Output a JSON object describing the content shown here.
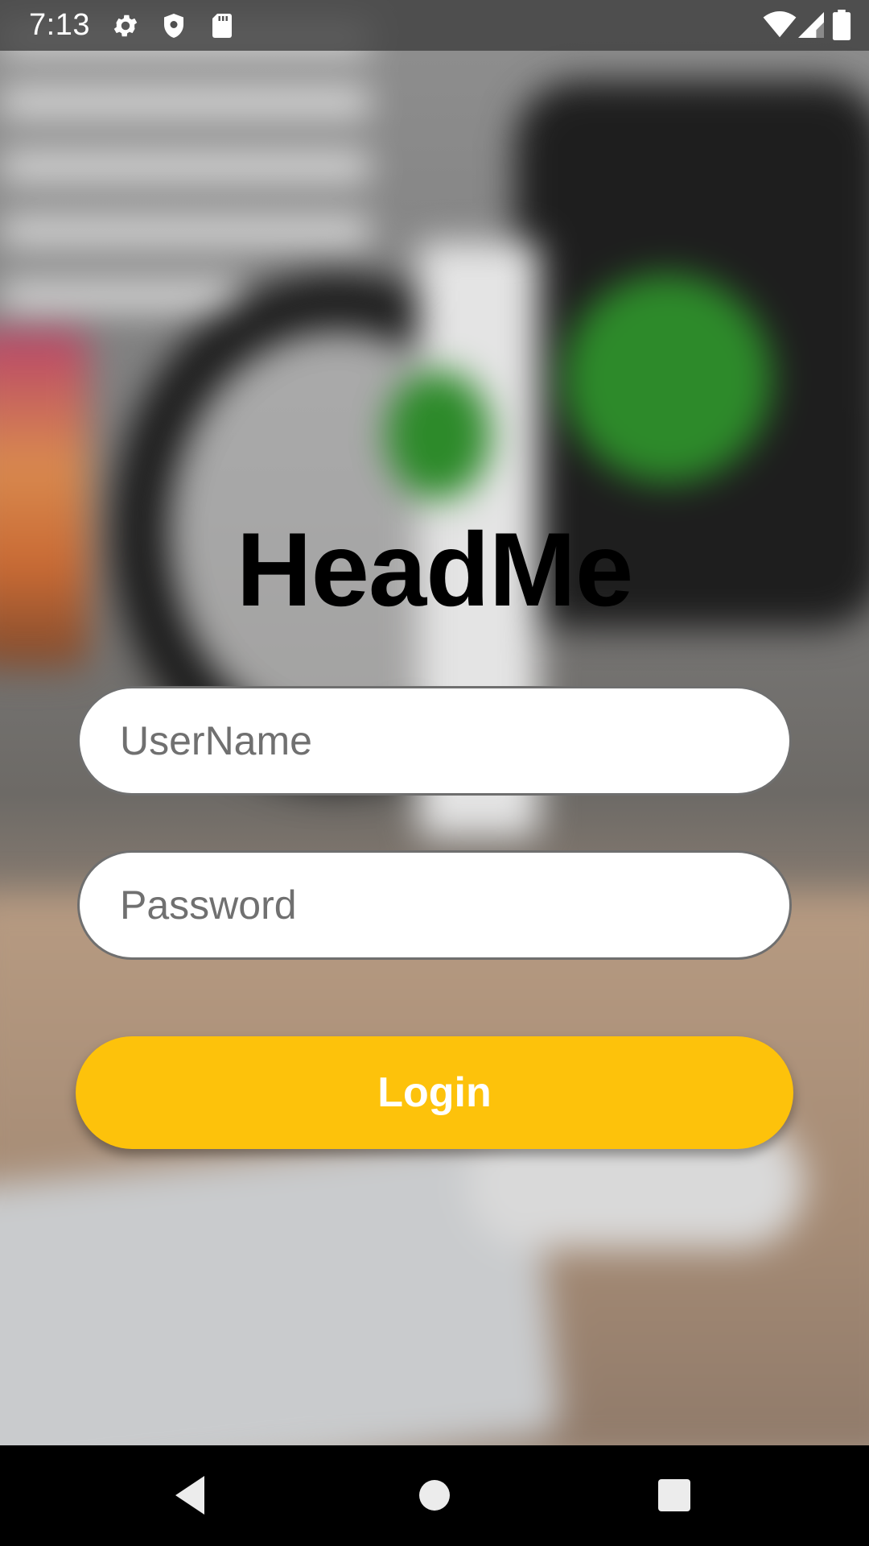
{
  "status_bar": {
    "time": "7:13",
    "icons": [
      "gear-icon",
      "shield-icon",
      "sdcard-icon",
      "wifi-icon",
      "signal-icon",
      "battery-icon"
    ]
  },
  "app": {
    "title": "HeadMe"
  },
  "form": {
    "username_placeholder": "UserName",
    "username_value": "",
    "password_placeholder": "Password",
    "password_value": "",
    "login_label": "Login"
  },
  "nav_bar": {
    "buttons": [
      "back-icon",
      "home-icon",
      "recents-icon"
    ]
  },
  "colors": {
    "accent": "#fdc20b",
    "title": "#000000",
    "field_background": "#ffffff",
    "field_border": "#6f6f6f"
  }
}
